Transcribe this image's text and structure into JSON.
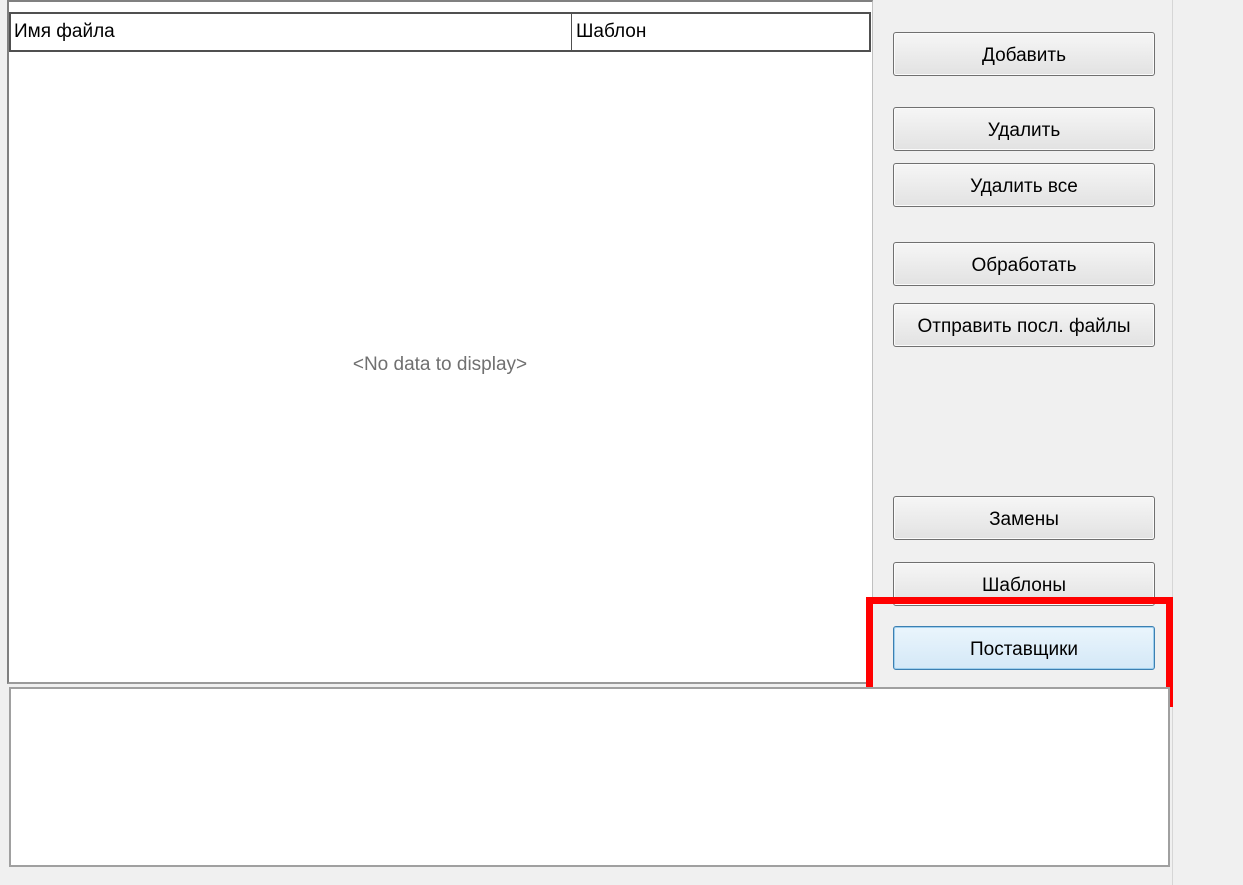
{
  "grid": {
    "columns": [
      "Имя файла",
      "Шаблон"
    ],
    "empty_text": "<No data to display>"
  },
  "buttons": {
    "add": "Добавить",
    "delete": "Удалить",
    "delete_all": "Удалить все",
    "process": "Обработать",
    "send_last_files": "Отправить посл. файлы",
    "replacements": "Замены",
    "templates": "Шаблоны",
    "suppliers": "Поставщики"
  },
  "log": {
    "text": ""
  },
  "highlight_color": "#ff0000"
}
